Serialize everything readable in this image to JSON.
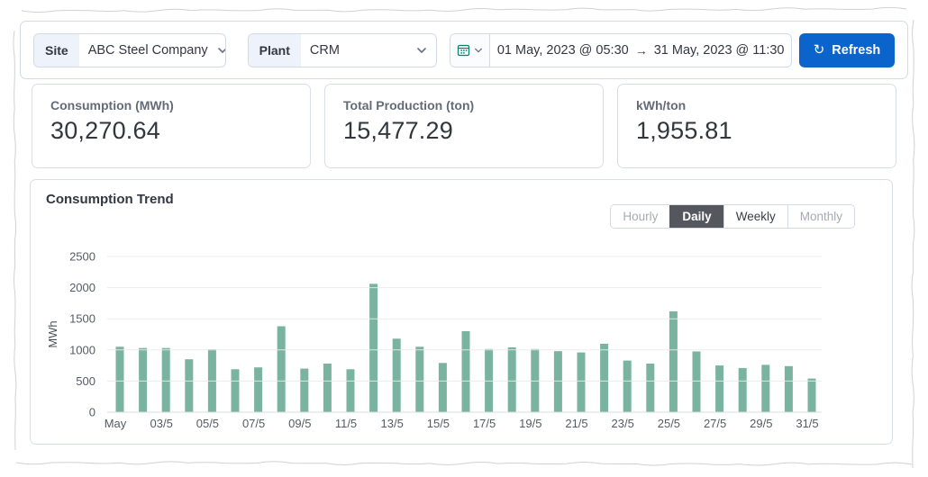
{
  "filter_bar": {
    "site": {
      "label": "Site",
      "value": "ABC Steel Company"
    },
    "plant": {
      "label": "Plant",
      "value": "CRM"
    },
    "date_range": {
      "start": "01 May, 2023 @ 05:30",
      "separator": "→",
      "end": "31 May, 2023 @ 11:30"
    },
    "refresh_label": "Refresh",
    "icons": {
      "refresh": "↻",
      "calendar": "calendar-icon",
      "chevron_down": "chevron-down-icon"
    }
  },
  "kpi": {
    "cards": [
      {
        "label": "Consumption (MWh)",
        "value": "30,270.64"
      },
      {
        "label": "Total Production (ton)",
        "value": "15,477.29"
      },
      {
        "label": "kWh/ton",
        "value": "1,955.81"
      }
    ]
  },
  "trend": {
    "title": "Consumption Trend",
    "tabs": [
      {
        "label": "Hourly",
        "state": "muted",
        "selected": false
      },
      {
        "label": "Daily",
        "state": "selected",
        "selected": true
      },
      {
        "label": "Weekly",
        "state": "normal",
        "selected": false
      },
      {
        "label": "Monthly",
        "state": "muted",
        "selected": false
      }
    ]
  },
  "chart_data": {
    "type": "bar",
    "title": "Consumption Trend",
    "xlabel": "",
    "ylabel": "MWh",
    "ylim": [
      0,
      2500
    ],
    "yticks": [
      0,
      500,
      1000,
      1500,
      2000,
      2500
    ],
    "grid": true,
    "legend": false,
    "bar_color": "#7ab4a0",
    "grid_color": "#e9eaee",
    "axis_color": "#d9dbdf",
    "tick_text_color": "#565b63",
    "categories": [
      "01/5",
      "02/5",
      "03/5",
      "04/5",
      "05/5",
      "06/5",
      "07/5",
      "08/5",
      "09/5",
      "10/5",
      "11/5",
      "12/5",
      "13/5",
      "14/5",
      "15/5",
      "16/5",
      "17/5",
      "18/5",
      "19/5",
      "20/5",
      "21/5",
      "22/5",
      "23/5",
      "24/5",
      "25/5",
      "26/5",
      "27/5",
      "28/5",
      "29/5",
      "30/5",
      "31/5"
    ],
    "values": [
      1050,
      1030,
      1030,
      850,
      1010,
      690,
      720,
      1380,
      700,
      780,
      690,
      2060,
      1180,
      1050,
      790,
      1300,
      1015,
      1040,
      1015,
      980,
      960,
      1100,
      830,
      780,
      1620,
      975,
      750,
      710,
      760,
      740,
      540
    ],
    "x_tick_labels": [
      "May",
      "03/5",
      "05/5",
      "07/5",
      "09/5",
      "11/5",
      "13/5",
      "15/5",
      "17/5",
      "19/5",
      "21/5",
      "23/5",
      "25/5",
      "27/5",
      "29/5",
      "31/5"
    ],
    "x_tick_every": 2
  },
  "colors": {
    "primary_button": "#0b64cc",
    "calendar_icon": "#0f7e6b",
    "panel_border": "#d3dae6",
    "selected_tab_bg": "#55575f"
  }
}
